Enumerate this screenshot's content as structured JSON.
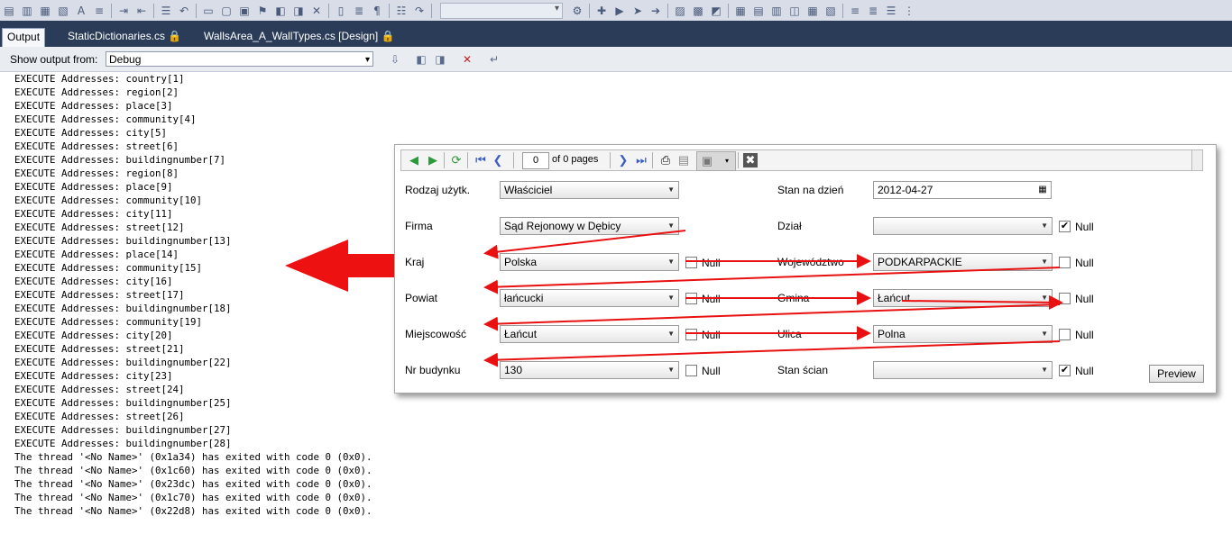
{
  "tabs": [
    {
      "label": "Output",
      "active": true
    },
    {
      "label": "StaticDictionaries.cs 🔒",
      "active": false
    },
    {
      "label": "WallsArea_A_WallTypes.cs [Design] 🔒",
      "active": false
    }
  ],
  "output_bar": {
    "label": "Show output from:",
    "source": "Debug"
  },
  "output_lines": [
    "EXECUTE Addresses: country[1]",
    "EXECUTE Addresses: region[2]",
    "EXECUTE Addresses: place[3]",
    "EXECUTE Addresses: community[4]",
    "EXECUTE Addresses: city[5]",
    "EXECUTE Addresses: street[6]",
    "EXECUTE Addresses: buildingnumber[7]",
    "EXECUTE Addresses: region[8]",
    "EXECUTE Addresses: place[9]",
    "EXECUTE Addresses: community[10]",
    "EXECUTE Addresses: city[11]",
    "EXECUTE Addresses: street[12]",
    "EXECUTE Addresses: buildingnumber[13]",
    "EXECUTE Addresses: place[14]",
    "EXECUTE Addresses: community[15]",
    "EXECUTE Addresses: city[16]",
    "EXECUTE Addresses: street[17]",
    "EXECUTE Addresses: buildingnumber[18]",
    "EXECUTE Addresses: community[19]",
    "EXECUTE Addresses: city[20]",
    "EXECUTE Addresses: street[21]",
    "EXECUTE Addresses: buildingnumber[22]",
    "EXECUTE Addresses: city[23]",
    "EXECUTE Addresses: street[24]",
    "EXECUTE Addresses: buildingnumber[25]",
    "EXECUTE Addresses: street[26]",
    "EXECUTE Addresses: buildingnumber[27]",
    "EXECUTE Addresses: buildingnumber[28]",
    "The thread '<No Name>' (0x1a34) has exited with code 0 (0x0).",
    "The thread '<No Name>' (0x1c60) has exited with code 0 (0x0).",
    "The thread '<No Name>' (0x23dc) has exited with code 0 (0x0).",
    "The thread '<No Name>' (0x1c70) has exited with code 0 (0x0).",
    "The thread '<No Name>' (0x22d8) has exited with code 0 (0x0)."
  ],
  "report_toolbar": {
    "page": "0",
    "page_of": "of 0 pages"
  },
  "form": {
    "rodzaj_label": "Rodzaj użytk.",
    "rodzaj_value": "Właściciel",
    "stan_label": "Stan na dzień",
    "stan_value": "2012-04-27",
    "firma_label": "Firma",
    "firma_value": "Sąd Rejonowy w Dębicy",
    "dzial_label": "Dział",
    "dzial_value": "",
    "dzial_null": true,
    "kraj_label": "Kraj",
    "kraj_value": "Polska",
    "kraj_null": false,
    "woj_label": "Województwo",
    "woj_value": "PODKARPACKIE",
    "woj_null": false,
    "powiat_label": "Powiat",
    "powiat_value": "łańcucki",
    "powiat_null": false,
    "gmina_label": "Gmina",
    "gmina_value": "Łańcut",
    "gmina_null": false,
    "miejsc_label": "Miejscowość",
    "miejsc_value": "Łańcut",
    "miejsc_null": false,
    "ulica_label": "Ulica",
    "ulica_value": "Polna",
    "ulica_null": false,
    "nr_label": "Nr budynku",
    "nr_value": "130",
    "nr_null": false,
    "sciany_label": "Stan ścian",
    "sciany_value": "",
    "sciany_null": true,
    "null_text": "Null",
    "preview_label": "Preview"
  },
  "colors": {
    "annotation_red": "#e81010",
    "tab_bar": "#2b3c59",
    "toolbar": "#d8dde8"
  }
}
